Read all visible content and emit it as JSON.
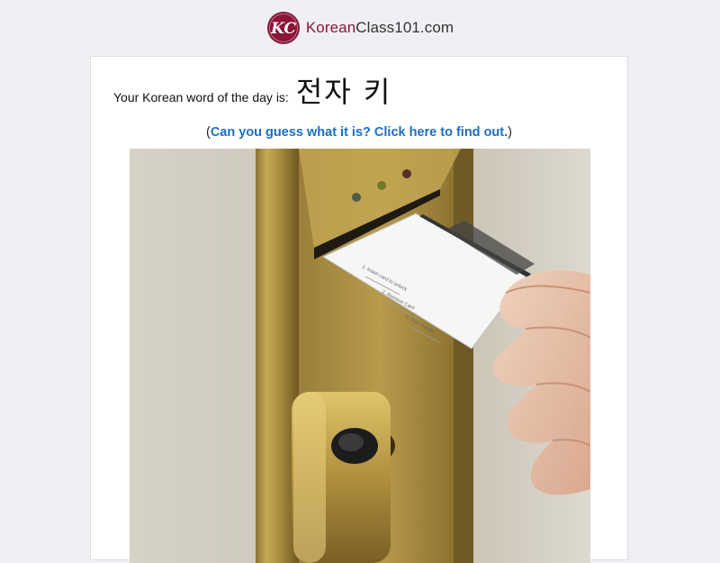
{
  "header": {
    "logo": {
      "mark": "KC",
      "name_part1": "Korean",
      "name_part2": "Class101.com"
    }
  },
  "wotd": {
    "label": "Your Korean word of the day is:",
    "word": "전자 키"
  },
  "guess": {
    "open": "(",
    "link": "Can you guess what it is? Click here to find out.",
    "close": ")"
  },
  "photo": {
    "card_text": {
      "step1": "1. Insert card to unlock",
      "step2": "2. Remove Card",
      "step3": "3. Turn Handle"
    }
  },
  "colors": {
    "brand": "#8a1538",
    "link": "#1a6fc2"
  }
}
